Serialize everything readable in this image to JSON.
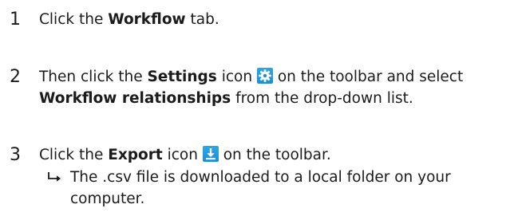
{
  "steps": [
    {
      "number": "1",
      "prefix": "Click the ",
      "bold": "Workflow",
      "suffix": " tab."
    },
    {
      "number": "2",
      "prefix": "Then click the ",
      "bold": "Settings",
      "mid": " icon ",
      "after_icon": " on the toolbar and select ",
      "bold2": "Workflow relationships",
      "suffix": " from the drop-down list.",
      "icon": "gear-icon"
    },
    {
      "number": "3",
      "prefix": "Click the ",
      "bold": "Export",
      "mid": " icon ",
      "after_icon": " on the toolbar.",
      "icon": "download-icon",
      "result": "The .csv file is downloaded to a local folder on your computer."
    }
  ],
  "colors": {
    "text": "#1b1b1b",
    "icon_blue": "#1b8fd6"
  }
}
